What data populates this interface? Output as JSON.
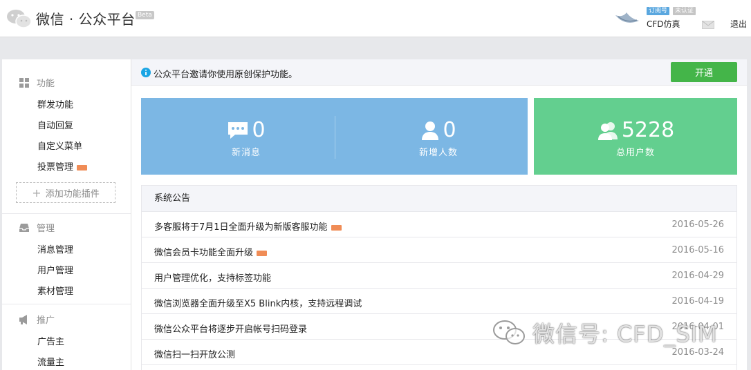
{
  "header": {
    "title": "微信 · 公众平台",
    "beta": "Beta",
    "account_type": "订阅号",
    "verify_status": "未认证",
    "account_name": "CFD仿真",
    "logout": "退出"
  },
  "sidebar": {
    "function_title": "功能",
    "function_items": [
      "群发功能",
      "自动回复",
      "自定义菜单",
      "投票管理"
    ],
    "add_plugin": "添加功能插件",
    "manage_title": "管理",
    "manage_items": [
      "消息管理",
      "用户管理",
      "素材管理"
    ],
    "promote_title": "推广",
    "promote_items": [
      "广告主",
      "流量主"
    ]
  },
  "notice": {
    "text": "公众平台邀请你使用原创保护功能。",
    "button": "开通"
  },
  "stats": [
    {
      "value": "0",
      "label": "新消息"
    },
    {
      "value": "0",
      "label": "新增人数"
    },
    {
      "value": "5228",
      "label": "总用户数"
    }
  ],
  "announcements": {
    "title": "系统公告",
    "items": [
      {
        "title": "多客服将于7月1日全面升级为新版客服功能",
        "date": "2016-05-26"
      },
      {
        "title": "微信会员卡功能全面升级",
        "date": "2016-05-16"
      },
      {
        "title": "用户管理优化，支持标签功能",
        "date": "2016-04-29"
      },
      {
        "title": "微信浏览器全面升级至X5 Blink内核，支持远程调试",
        "date": "2016-04-19"
      },
      {
        "title": "微信公众平台将逐步开启帐号扫码登录",
        "date": "2016-04-01"
      },
      {
        "title": "微信扫一扫开放公测",
        "date": "2016-03-24"
      }
    ]
  },
  "watermark": "微信号: CFD_SIM",
  "colors": {
    "stat_blue": "#7cb7e4",
    "stat_green": "#63cf8f",
    "open_button": "#44b549",
    "new_badge": "#f08c56"
  }
}
